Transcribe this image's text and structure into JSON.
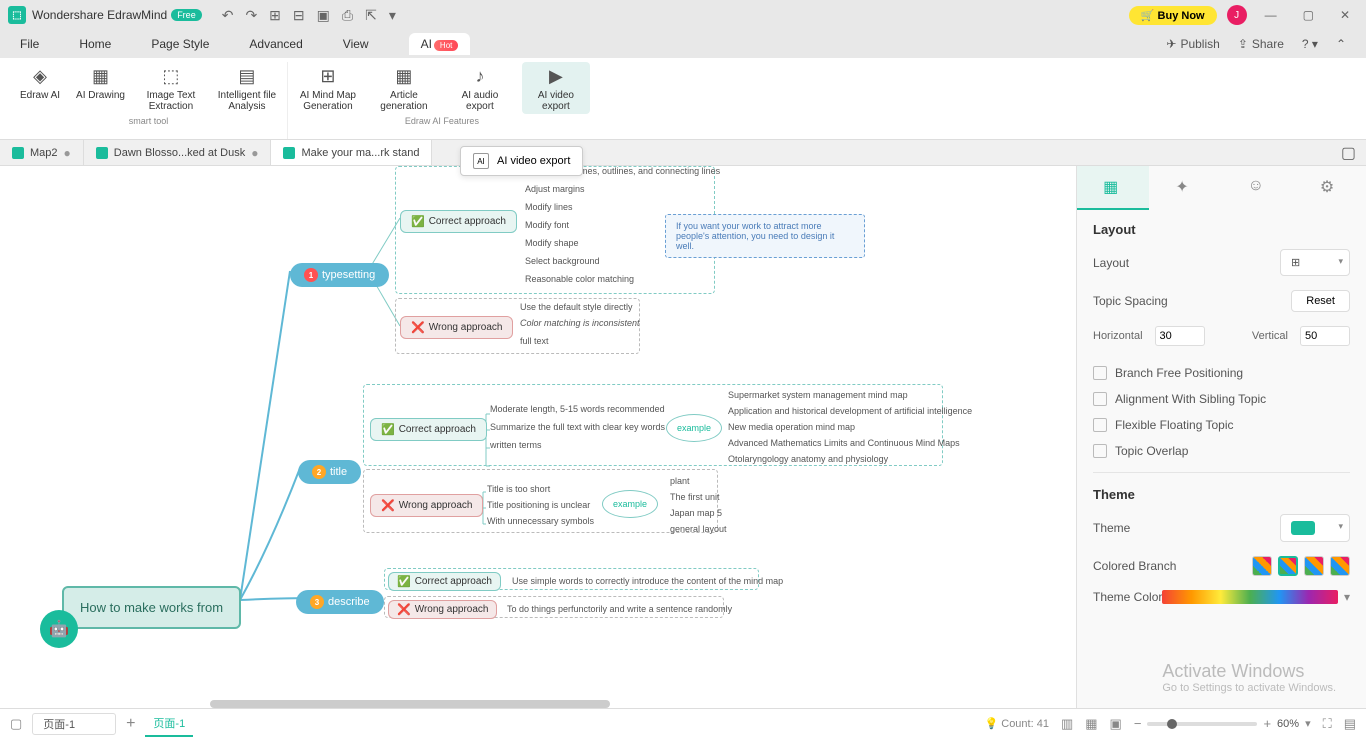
{
  "app": {
    "title": "Wondershare EdrawMind",
    "badge": "Free",
    "buyNow": "🛒 Buy Now",
    "avatar": "J"
  },
  "menu": {
    "file": "File",
    "home": "Home",
    "pageStyle": "Page Style",
    "advanced": "Advanced",
    "view": "View",
    "ai": "AI",
    "hot": "Hot",
    "publish": "Publish",
    "share": "Share"
  },
  "ribbon": {
    "edrawAI": "Edraw\nAI",
    "aiDrawing": "AI\nDrawing",
    "imageText": "Image Text\nExtraction",
    "intelligent": "Intelligent\nfile Analysis",
    "smartTool": "smart tool",
    "aiMindMap": "AI Mind Map\nGeneration",
    "article": "Article\ngeneration",
    "aiAudio": "AI audio\nexport",
    "aiVideo": "AI video\nexport",
    "features": "Edraw AI Features"
  },
  "tabs": {
    "t1": "Map2",
    "t2": "Dawn Blosso...ked at Dusk",
    "t3": "Make your ma...rk stand"
  },
  "tooltip": "AI video export",
  "mindmap": {
    "root": "How to make works from",
    "b1": "typesetting",
    "b2": "title",
    "b3": "describe",
    "correct": "Correct approach",
    "wrong": "Wrong approach",
    "ts_header": "ames, outlines, and connecting lines",
    "ts1": "Adjust margins",
    "ts2": "Modify lines",
    "ts3": "Modify font",
    "ts4": "Modify shape",
    "ts5": "Select background",
    "ts6": "Reasonable color matching",
    "tw1": "Use the default style directly",
    "tw2": "Color matching is inconsistent",
    "tw3": "full text",
    "tc1": "Moderate length, 5-15 words recommended",
    "tc2": "Summarize the full text with clear key words",
    "tc3": "written terms",
    "example": "example",
    "ex1": "Supermarket system management mind map",
    "ex2": "Application and historical development of artificial intelligence",
    "ex3": "New media operation mind map",
    "ex4": "Advanced Mathematics Limits and Continuous Mind Maps",
    "ex5": "Otolaryngology anatomy and physiology",
    "tw_t1": "Title is too short",
    "tw_t2": "Title positioning is unclear",
    "tw_t3": "With unnecessary symbols",
    "twe1": "plant",
    "twe2": "The first unit",
    "twe3": "Japan map 5",
    "twe4": "general layout",
    "dc": "Use simple words to correctly introduce the content of the mind map",
    "dw": "To do things perfunctorily and write a sentence randomly",
    "note": "If you want your work to attract more people's attention, you need to design it well."
  },
  "sidepanel": {
    "layout": "Layout",
    "layoutLabel": "Layout",
    "topicSpacing": "Topic Spacing",
    "reset": "Reset",
    "horizontal": "Horizontal",
    "hVal": "30",
    "vertical": "Vertical",
    "vVal": "50",
    "branchFree": "Branch Free Positioning",
    "alignSibling": "Alignment With Sibling Topic",
    "flexFloating": "Flexible Floating Topic",
    "topicOverlap": "Topic Overlap",
    "theme": "Theme",
    "themeLabel": "Theme",
    "coloredBranch": "Colored Branch",
    "themeColor": "Theme Color"
  },
  "statusbar": {
    "page": "页面-1",
    "pageTab": "页面-1",
    "count": "Count: 41",
    "zoom": "60%"
  },
  "watermark": {
    "line1": "Activate Windows",
    "line2": "Go to Settings to activate Windows."
  }
}
